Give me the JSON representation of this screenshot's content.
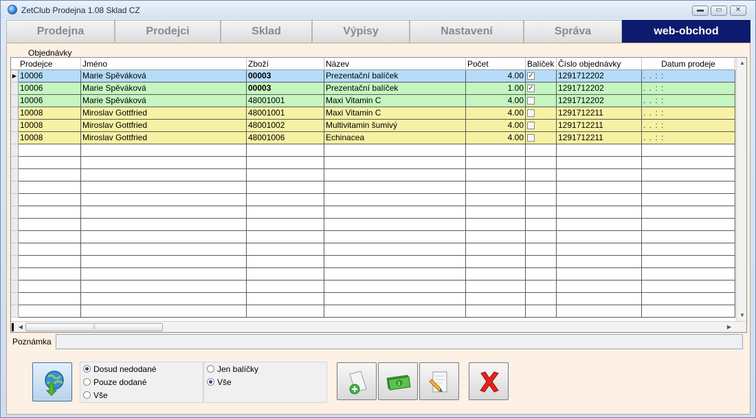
{
  "window": {
    "title": "ZetClub Prodejna 1.08  Sklad CZ",
    "controls": [
      "minimize",
      "maximize",
      "close"
    ]
  },
  "tabs": [
    {
      "label": "Prodejna",
      "active": false
    },
    {
      "label": "Prodejci",
      "active": false
    },
    {
      "label": "Sklad",
      "active": false
    },
    {
      "label": "Výpisy",
      "active": false
    },
    {
      "label": "Nastavení",
      "active": false
    },
    {
      "label": "Správa",
      "active": false
    },
    {
      "label": "web-obchod",
      "active": true
    }
  ],
  "orders": {
    "section_label": "Objednávky",
    "columns": [
      "Prodejce",
      "Jméno",
      "Zboží",
      "Název",
      "Počet",
      "Balíček",
      "Číslo objednávky",
      "Datum prodeje"
    ],
    "rows": [
      {
        "prodejce": "10006",
        "jmeno": "Marie Spěváková",
        "zbozi": "00003",
        "nazev": "Prezentační balíček",
        "pocet": "4.00",
        "balicek": true,
        "cislo": "1291712202",
        "datum": ". .   : :",
        "color": "blue",
        "current": true,
        "bold_zbozi": true
      },
      {
        "prodejce": "10006",
        "jmeno": "Marie Spěváková",
        "zbozi": "00003",
        "nazev": "Prezentační balíček",
        "pocet": "1.00",
        "balicek": true,
        "cislo": "1291712202",
        "datum": ". .   : :",
        "color": "green",
        "current": false,
        "bold_zbozi": true
      },
      {
        "prodejce": "10006",
        "jmeno": "Marie Spěváková",
        "zbozi": "48001001",
        "nazev": "Maxi Vitamin C",
        "pocet": "4.00",
        "balicek": false,
        "cislo": "1291712202",
        "datum": ". .   : :",
        "color": "green",
        "current": false,
        "bold_zbozi": false
      },
      {
        "prodejce": "10008",
        "jmeno": "Miroslav Gottfried",
        "zbozi": "48001001",
        "nazev": "Maxi Vitamin C",
        "pocet": "4.00",
        "balicek": false,
        "cislo": "1291712211",
        "datum": ". .   : :",
        "color": "yellow",
        "current": false,
        "bold_zbozi": false
      },
      {
        "prodejce": "10008",
        "jmeno": "Miroslav Gottfried",
        "zbozi": "48001002",
        "nazev": "Multivitamin šumivý",
        "pocet": "4.00",
        "balicek": false,
        "cislo": "1291712211",
        "datum": ". .   : :",
        "color": "yellow",
        "current": false,
        "bold_zbozi": false
      },
      {
        "prodejce": "10008",
        "jmeno": "Miroslav Gottfried",
        "zbozi": "48001006",
        "nazev": "Echinacea",
        "pocet": "4.00",
        "balicek": false,
        "cislo": "1291712211",
        "datum": ". .   : :",
        "color": "yellow",
        "current": false,
        "bold_zbozi": false
      }
    ],
    "row_colors": {
      "blue": "#b5dcfa",
      "green": "#c5f5c0",
      "yellow": "#f7f1a4"
    }
  },
  "note": {
    "label": "Poznámka",
    "value": ""
  },
  "filters": {
    "delivery": {
      "options": [
        "Dosud nedodané",
        "Pouze dodané",
        "Vše"
      ],
      "selected": "Dosud nedodané"
    },
    "type": {
      "options": [
        "Jen balíčky",
        "Vše"
      ],
      "selected": "Vše"
    }
  },
  "actions": [
    {
      "name": "refresh-button",
      "icon": "globe-download-icon"
    },
    {
      "name": "add-document-button",
      "icon": "add-document-icon"
    },
    {
      "name": "money-button",
      "icon": "banknote-icon"
    },
    {
      "name": "edit-document-button",
      "icon": "edit-document-icon"
    },
    {
      "name": "delete-button",
      "icon": "red-x-icon"
    }
  ],
  "colors": {
    "active_tab": "#0d1b6e",
    "content_background": "#fdf0e4"
  }
}
